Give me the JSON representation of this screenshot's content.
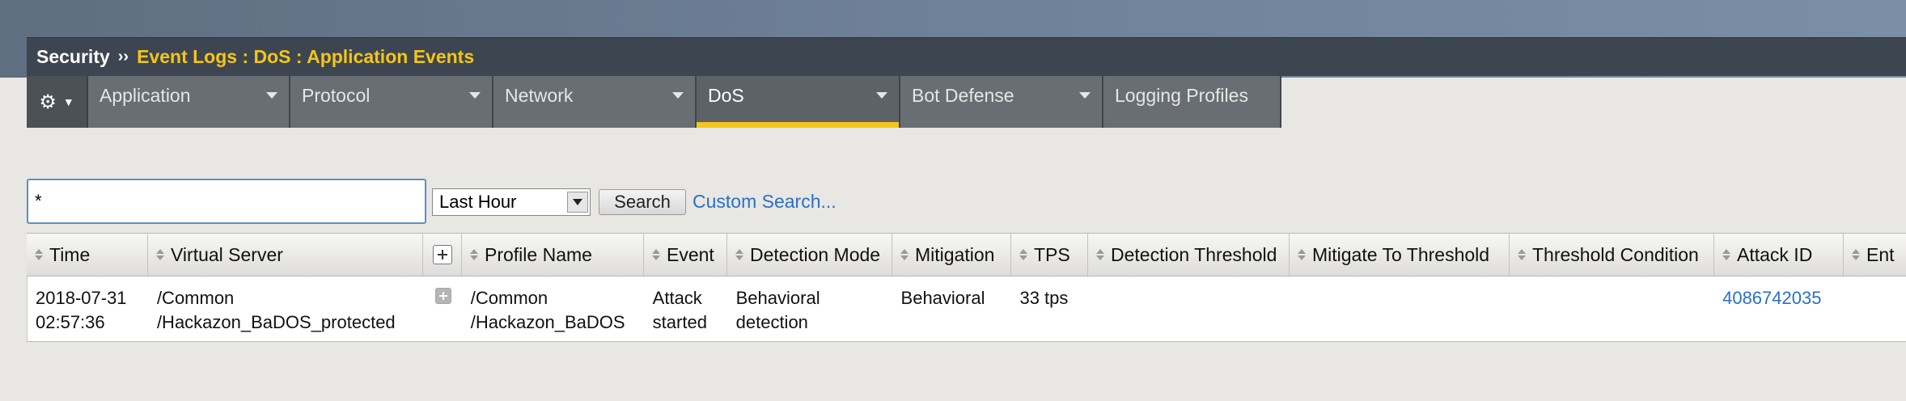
{
  "breadcrumb": {
    "root": "Security",
    "separator": "››",
    "page": "Event Logs : DoS : Application Events"
  },
  "menu": {
    "gear_icon": "gear-icon",
    "tabs": [
      {
        "label": "Application"
      },
      {
        "label": "Protocol"
      },
      {
        "label": "Network"
      },
      {
        "label": "DoS",
        "active": true
      },
      {
        "label": "Bot Defense"
      },
      {
        "label": "Logging Profiles"
      }
    ]
  },
  "search": {
    "value": "*",
    "time_range": "Last Hour",
    "button_label": "Search",
    "custom_link": "Custom Search..."
  },
  "table": {
    "headers": [
      "Time",
      "Virtual Server",
      "Profile Name",
      "Event",
      "Detection Mode",
      "Mitigation",
      "TPS",
      "Detection Threshold",
      "Mitigate To Threshold",
      "Threshold Condition",
      "Attack ID",
      "Ent"
    ],
    "rows": [
      {
        "time": [
          "2018-07-31",
          "02:57:36"
        ],
        "virtual_server": [
          "/Common",
          "/Hackazon_BaDOS_protected"
        ],
        "profile_name": [
          "/Common",
          "/Hackazon_BaDOS"
        ],
        "event": [
          "Attack",
          "started"
        ],
        "detection_mode": [
          "Behavioral",
          "detection"
        ],
        "mitigation": "Behavioral",
        "tps": "33 tps",
        "detection_threshold": "",
        "mitigate_to_threshold": "",
        "threshold_condition": "",
        "attack_id": "4086742035"
      }
    ]
  },
  "colors": {
    "accent": "#f5c518",
    "link": "#2a6fc9",
    "titlebar": "#3d4650"
  }
}
